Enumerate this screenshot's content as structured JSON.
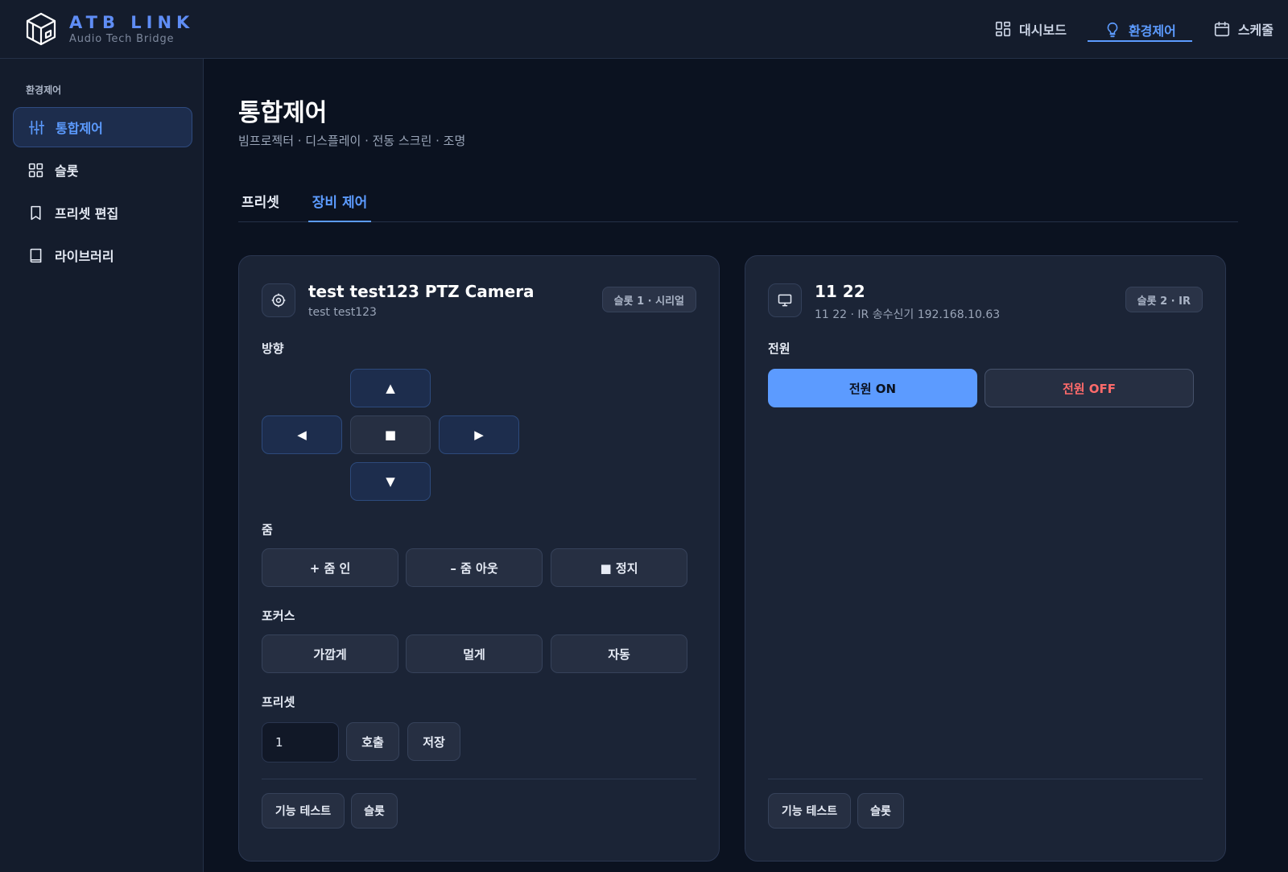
{
  "app": {
    "brand_title": "ATB LINK",
    "brand_subtitle": "Audio Tech Bridge"
  },
  "topnav": {
    "dashboard": "대시보드",
    "environment": "환경제어",
    "schedule": "스케줄"
  },
  "sidebar": {
    "section": "환경제어",
    "items": [
      {
        "label": "통합제어",
        "icon": "sliders-icon"
      },
      {
        "label": "슬롯",
        "icon": "grid-icon"
      },
      {
        "label": "프리셋 편집",
        "icon": "bookmark-icon"
      },
      {
        "label": "라이브러리",
        "icon": "book-icon"
      }
    ]
  },
  "page": {
    "title": "통합제어",
    "subtitle": "빔프로젝터 · 디스플레이 · 전동 스크린 · 조명"
  },
  "tabs": [
    "프리셋",
    "장비 제어"
  ],
  "camera_card": {
    "name": "test test123 PTZ Camera",
    "sub": "test test123",
    "badge": "슬롯 1 · 시리얼",
    "direction_label": "방향",
    "direction": {
      "up": "▲",
      "left": "◀",
      "stop": "■",
      "right": "▶",
      "down": "▼"
    },
    "zoom_label": "줌",
    "zoom": {
      "in": "+ 줌 인",
      "out": "– 줌 아웃",
      "stop": "■ 정지"
    },
    "focus_label": "포커스",
    "focus": {
      "near": "가깝게",
      "far": "멀게",
      "auto": "자동"
    },
    "preset_label": "프리셋",
    "preset_value": "1",
    "preset": {
      "recall": "호출",
      "save": "저장"
    },
    "footer": {
      "test": "기능 테스트",
      "slot": "슬롯"
    }
  },
  "ir_card": {
    "name": "11 22",
    "sub": "11 22 · IR 송수신기 192.168.10.63",
    "badge": "슬롯 2 · IR",
    "power_label": "전원",
    "power_on": "전원 ON",
    "power_off": "전원 OFF",
    "footer": {
      "test": "기능 테스트",
      "slot": "슬롯"
    }
  },
  "colors": {
    "accent": "#5c9bff",
    "danger": "#ff6b6b",
    "background": "#0b1220",
    "panel": "#1b2436"
  }
}
